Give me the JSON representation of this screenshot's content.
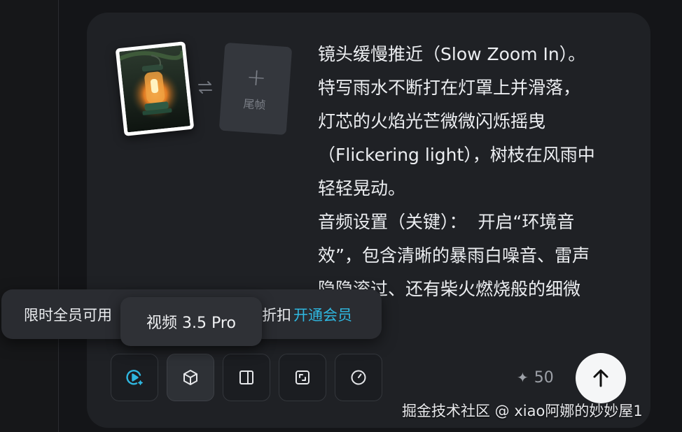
{
  "prompt": {
    "text": "镜头缓慢推近（Slow Zoom In）。\n特写雨水不断打在灯罩上并滑落，\n灯芯的火焰光芒微微闪烁摇曳\n（Flickering light），树枝在风雨中\n轻轻晃动。\n音频设置（关键）：  开启“环境音\n效”，包含清晰的暴雨白噪音、雷声\n隐隐滚过、还有柴火燃烧般的细微"
  },
  "frames": {
    "start_image": "lantern-in-rain",
    "tail_label": "尾帧",
    "tail_plus": "+"
  },
  "promo": {
    "text_left": "限时全员可用",
    "text_right": "折扣",
    "link": "开通会员"
  },
  "tooltip": {
    "model": "视频 3.5 Pro"
  },
  "toolbar": {
    "buttons": [
      {
        "icon": "video-generate-icon",
        "active": false
      },
      {
        "icon": "cube-model-icon",
        "active": true
      },
      {
        "icon": "aspect-ratio-icon",
        "active": false
      },
      {
        "icon": "resolution-icon",
        "active": false
      },
      {
        "icon": "duration-icon",
        "active": false
      }
    ],
    "credits": "50",
    "credits_icon": "sparkle-icon",
    "send_icon": "arrow-up-icon"
  },
  "watermark": "掘金技术社区 @ xiao阿娜的妙妙屋1",
  "colors": {
    "accent": "#2fb7e0",
    "card": "#1f2125",
    "background": "#141518"
  }
}
